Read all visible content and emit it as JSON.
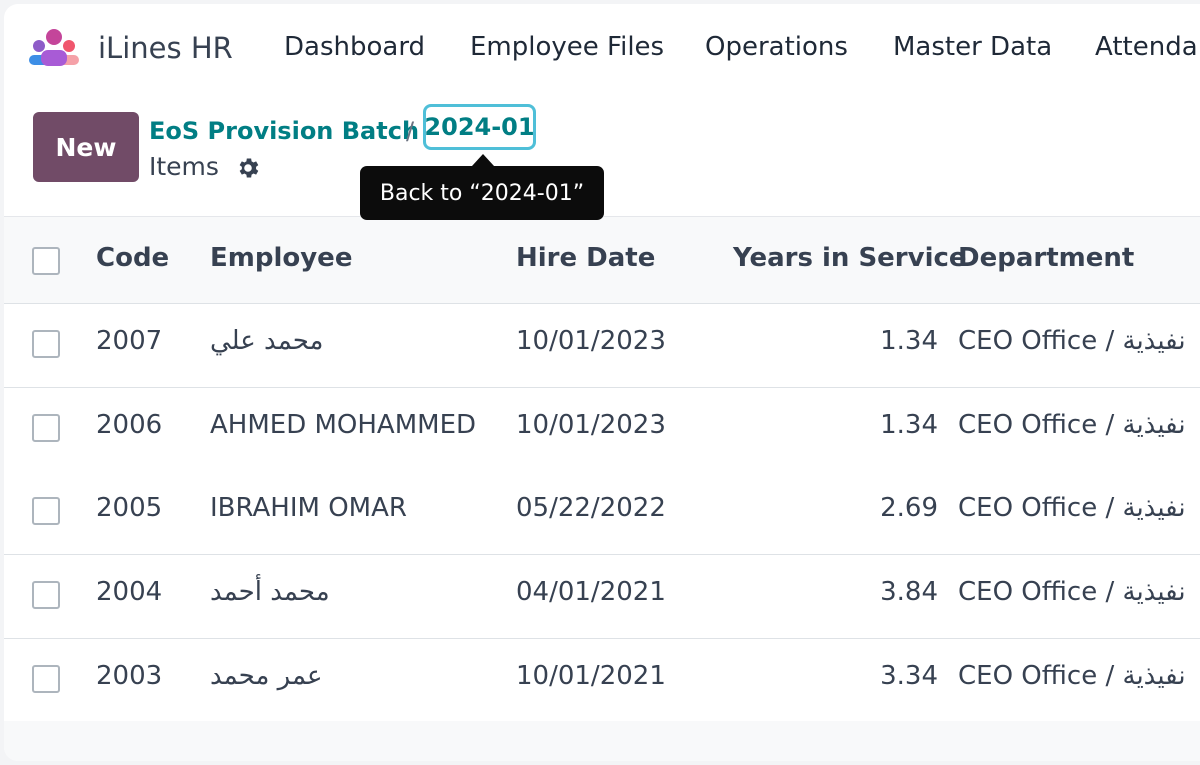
{
  "app": {
    "name": "iLines HR"
  },
  "nav": {
    "menus": [
      "Dashboard",
      "Employee Files",
      "Operations",
      "Master Data",
      "Attenda"
    ]
  },
  "control_panel": {
    "new_label": "New",
    "breadcrumb": {
      "parent": "EoS Provision Batch",
      "separator": "/",
      "current": "2024-01"
    },
    "title": "Items",
    "tooltip": "Back to “2024-01”"
  },
  "table": {
    "columns": [
      "Code",
      "Employee",
      "Hire Date",
      "Years in Service",
      "Department"
    ],
    "rows": [
      {
        "code": "2007",
        "employee": "محمد علي",
        "hire_date": "10/01/2023",
        "years": "1.34",
        "department": "CEO Office / نفيذية"
      },
      {
        "code": "2006",
        "employee": "AHMED MOHAMMED",
        "hire_date": "10/01/2023",
        "years": "1.34",
        "department": "CEO Office / نفيذية"
      },
      {
        "code": "2005",
        "employee": "IBRAHIM OMAR",
        "hire_date": "05/22/2022",
        "years": "2.69",
        "department": "CEO Office / نفيذية"
      },
      {
        "code": "2004",
        "employee": "محمد أحمد",
        "hire_date": "04/01/2021",
        "years": "3.84",
        "department": "CEO Office / نفيذية"
      },
      {
        "code": "2003",
        "employee": "عمر محمد",
        "hire_date": "10/01/2021",
        "years": "3.34",
        "department": "CEO Office / نفيذية"
      }
    ]
  },
  "colors": {
    "brand": "#714b67",
    "link": "#017e84",
    "focus": "#4fbfd8"
  }
}
